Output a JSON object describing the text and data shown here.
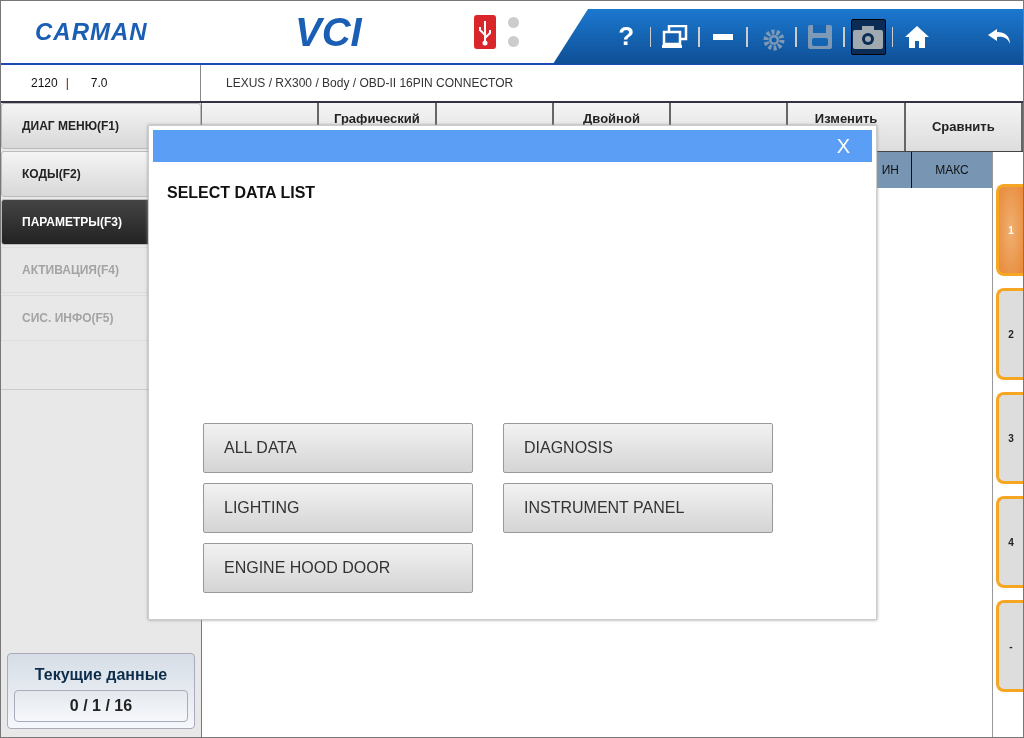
{
  "header": {
    "logo": "CARMAN",
    "product": "VCI",
    "tools": [
      {
        "kind": "help",
        "label": "?",
        "disabled": false,
        "selected": false
      },
      {
        "kind": "windows",
        "disabled": false,
        "selected": false
      },
      {
        "kind": "minimize",
        "disabled": false,
        "selected": false
      },
      {
        "kind": "settings",
        "disabled": true,
        "selected": false
      },
      {
        "kind": "save",
        "disabled": true,
        "selected": false
      },
      {
        "kind": "camera",
        "disabled": false,
        "selected": true
      },
      {
        "kind": "home",
        "disabled": false,
        "selected": false
      },
      {
        "kind": "back",
        "disabled": false,
        "selected": false
      }
    ]
  },
  "info_bar": {
    "code": "2120",
    "separator": "|",
    "version": "7.0",
    "path": "LEXUS / RX300 / Body / OBD-II 16PIN CONNECTOR"
  },
  "sidebar": {
    "items": [
      {
        "label": "ДИАГ МЕНЮ(F1)",
        "selected": false,
        "disabled": false
      },
      {
        "label": "КОДЫ(F2)",
        "selected": false,
        "disabled": false
      },
      {
        "label": "ПАРАМЕТРЫ(F3)",
        "selected": true,
        "disabled": false
      },
      {
        "label": "АКТИВАЦИЯ(F4)",
        "selected": false,
        "disabled": true
      },
      {
        "label": "СИС. ИНФО(F5)",
        "selected": false,
        "disabled": true
      }
    ],
    "status": {
      "title": "Текущие данные",
      "counts": "0 / 1 / 16"
    }
  },
  "toolbar": {
    "buttons": [
      {
        "kind": "blank"
      },
      {
        "kind": "labeled",
        "label": "Графический"
      },
      {
        "kind": "blank"
      },
      {
        "kind": "labeled",
        "label": "Двойной"
      },
      {
        "kind": "blank"
      },
      {
        "kind": "labeled",
        "label": "Изменить"
      },
      {
        "kind": "labeled",
        "label": "Сравнить"
      }
    ]
  },
  "table": {
    "columns": [
      "ИН",
      "МАКС"
    ]
  },
  "pages": [
    {
      "label": "1",
      "selected": true
    },
    {
      "label": "2",
      "selected": false
    },
    {
      "label": "3",
      "selected": false
    },
    {
      "label": "4",
      "selected": false
    },
    {
      "label": "-",
      "selected": false
    }
  ],
  "dialog": {
    "close": "X",
    "title": "SELECT DATA LIST",
    "options": [
      "ALL DATA",
      "DIAGNOSIS",
      "LIGHTING",
      "INSTRUMENT PANEL",
      "ENGINE HOOD DOOR"
    ]
  }
}
